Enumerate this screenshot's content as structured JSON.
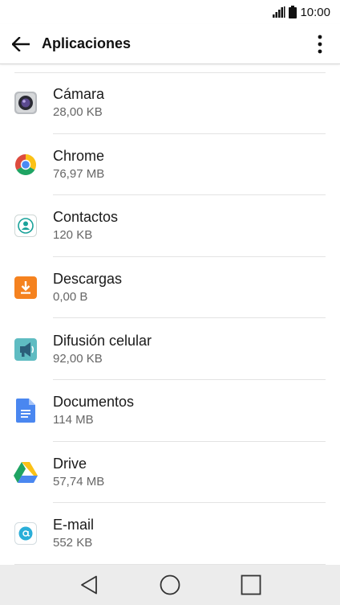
{
  "status": {
    "time": "10:00"
  },
  "header": {
    "title": "Aplicaciones"
  },
  "apps": [
    {
      "name": "Cámara",
      "size": "28,00 KB",
      "icon": "camera-icon"
    },
    {
      "name": "Chrome",
      "size": "76,97 MB",
      "icon": "chrome-icon"
    },
    {
      "name": "Contactos",
      "size": "120 KB",
      "icon": "contacts-icon"
    },
    {
      "name": "Descargas",
      "size": "0,00 B",
      "icon": "downloads-icon"
    },
    {
      "name": "Difusión celular",
      "size": "92,00 KB",
      "icon": "cell-broadcast-icon"
    },
    {
      "name": "Documentos",
      "size": "114 MB",
      "icon": "docs-icon"
    },
    {
      "name": "Drive",
      "size": "57,74 MB",
      "icon": "drive-icon"
    },
    {
      "name": "E-mail",
      "size": "552 KB",
      "icon": "email-icon"
    }
  ],
  "colors": {
    "accent": "#f5821f",
    "navbar": "#ececec"
  }
}
